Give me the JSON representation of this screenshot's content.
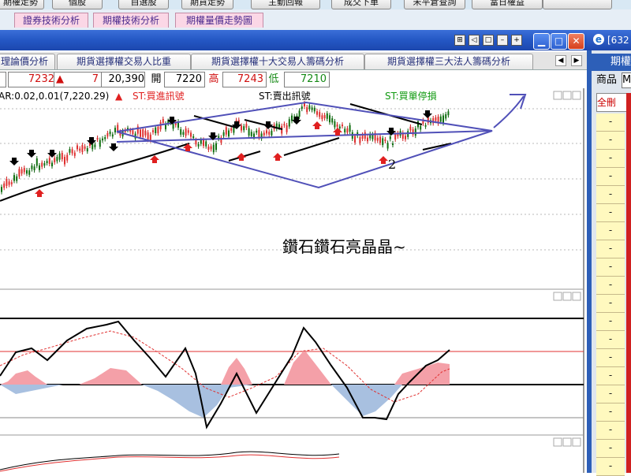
{
  "toolbar": {
    "buttons": [
      "期權走勢",
      "個股",
      "自選股",
      "期貨走勢",
      "主動回報",
      "成交下單",
      "未平倉查詢",
      "當日權益"
    ]
  },
  "tabs_top": [
    "證券技術分析",
    "期權技術分析",
    "期權量價走勢圖"
  ],
  "window": {
    "title": "",
    "buttons": [
      "minimize",
      "maximize",
      "close"
    ],
    "small_buttons": [
      "⊞",
      "◁",
      "□",
      "–",
      "+"
    ]
  },
  "tabs_second": [
    "理論價分析",
    "期貨選擇權交易人比重",
    "期貨選擇權十大交易人籌碼分析",
    "期貨選擇權三大法人籌碼分析"
  ],
  "quote": {
    "last": "7232",
    "change_arrow": "▲",
    "change": "7",
    "volume": "20,390",
    "open_label": "開",
    "open": "7220",
    "high_label": "高",
    "high": "7243",
    "low_label": "低",
    "low": "7210"
  },
  "indicator": {
    "sar": "AR:0.02,0.01(7,220.29)",
    "st_buy": "ST:買進訊號",
    "st_sell": "ST:賣出訊號",
    "st_stop": "ST:買單停損"
  },
  "annotation": {
    "text": "鑽石鑽石亮晶晶~",
    "label_2": "2"
  },
  "right_panel": {
    "title": "[632",
    "header": "期權",
    "product_label": "商品",
    "product_value": "M",
    "del_label": "全刪",
    "rows": [
      "-",
      "-",
      "-",
      "-",
      "-",
      "-",
      "-",
      "-",
      "-",
      "-",
      "-",
      "-",
      "-",
      "-",
      "-",
      "-",
      "-",
      "-",
      "-",
      "-"
    ]
  },
  "colors": {
    "title_blue": "#2457c4",
    "tab_pink": "#fbd7e6",
    "up_red": "#e02020",
    "down_black": "#000000",
    "diamond_purple": "#5050b8",
    "macd_pos": "#f4a0a8",
    "macd_neg": "#a8c0e0"
  }
}
